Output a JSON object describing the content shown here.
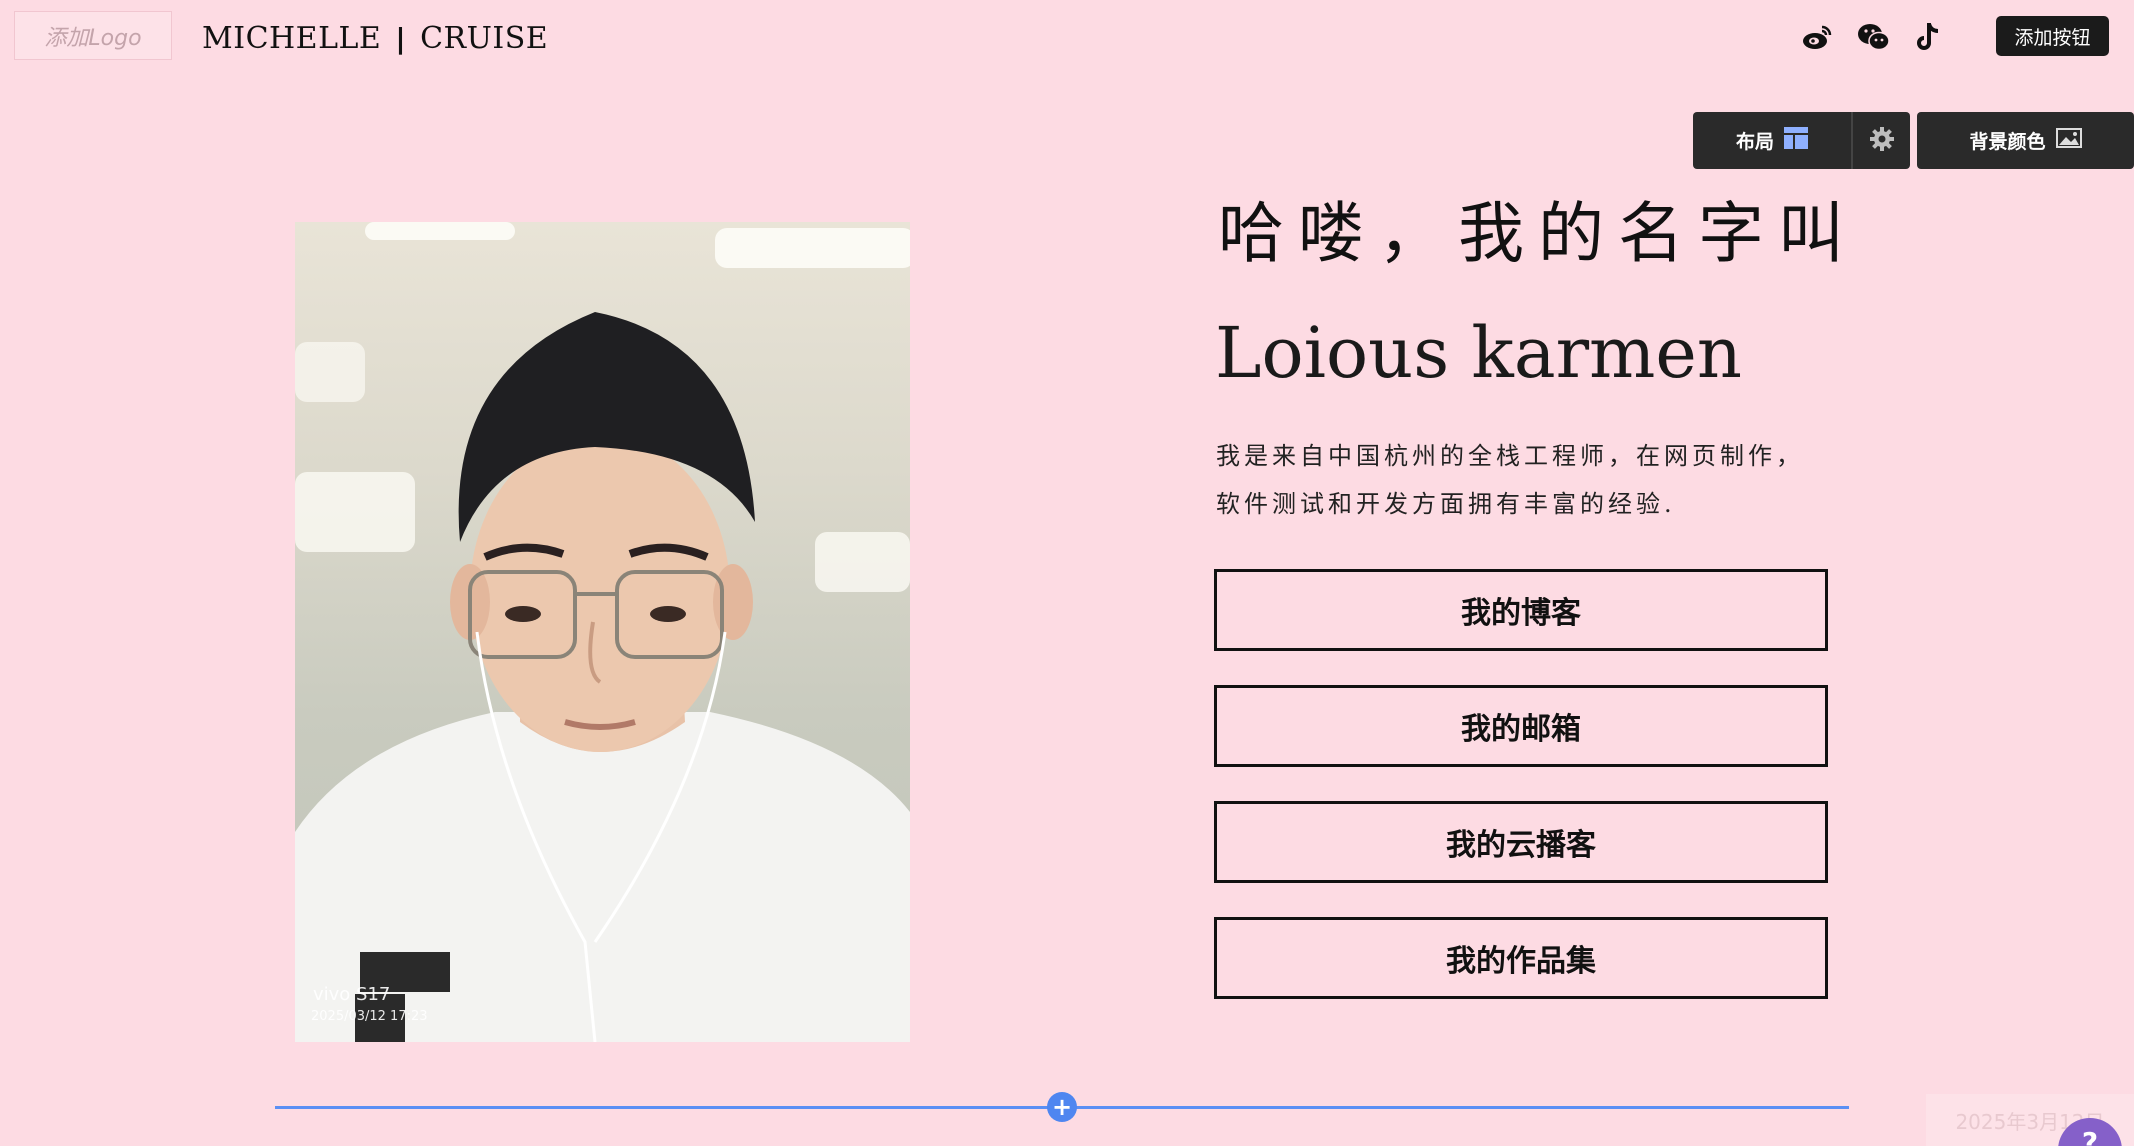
{
  "header": {
    "logo_placeholder": "添加Logo",
    "brand_left": "MICHELLE",
    "brand_sep": "|",
    "brand_right": "CRUISE",
    "social_icons": [
      "weibo-icon",
      "wechat-icon",
      "tiktok-icon"
    ],
    "add_button": "添加按钮"
  },
  "toolbar": {
    "layout_label": "布局",
    "background_label": "背景颜色"
  },
  "photo": {
    "watermark_device": "vivo S17",
    "watermark_time": "2025/03/12 17:23"
  },
  "hero": {
    "greeting": "哈喽，我的名字叫",
    "name": "Loious karmen",
    "intro_line1": "我是来自中国杭州的全栈工程师，在网页制作，",
    "intro_line2": "软件测试和开发方面拥有丰富的经验."
  },
  "links": [
    {
      "label": "我的博客"
    },
    {
      "label": "我的邮箱"
    },
    {
      "label": "我的云播客"
    },
    {
      "label": "我的作品集"
    }
  ],
  "footer": {
    "add_section": "+",
    "date_stamp": "2025年3月12日",
    "help": "?"
  },
  "colors": {
    "background": "#fddbe3",
    "toolbar": "#2a2a2a",
    "divider": "#5b8ff4",
    "help": "#8560c9"
  }
}
